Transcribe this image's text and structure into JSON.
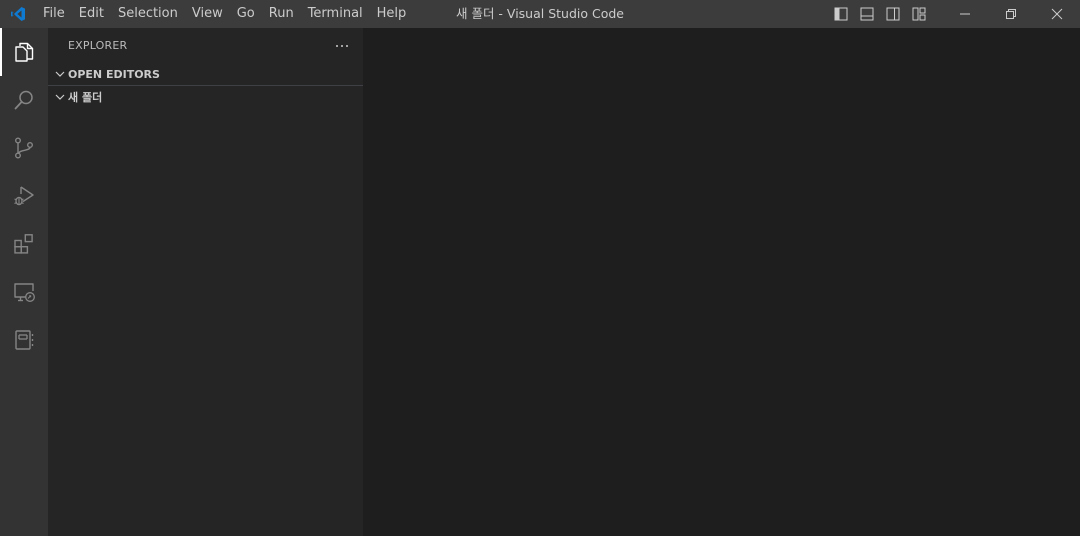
{
  "app": {
    "window_title": "새 폴더 - Visual Studio Code",
    "brand_color": "#0e7ad1"
  },
  "menu": {
    "items": [
      "File",
      "Edit",
      "Selection",
      "View",
      "Go",
      "Run",
      "Terminal",
      "Help"
    ]
  },
  "title_controls": {
    "layout_icons": [
      "toggle-primary-sidebar-icon",
      "toggle-panel-icon",
      "toggle-secondary-sidebar-icon",
      "customize-layout-icon"
    ],
    "window_icons": [
      "minimize-icon",
      "restore-icon",
      "close-icon"
    ]
  },
  "activity_bar": {
    "items": [
      {
        "icon": "explorer-icon",
        "active": true
      },
      {
        "icon": "search-icon",
        "active": false
      },
      {
        "icon": "source-control-icon",
        "active": false
      },
      {
        "icon": "run-debug-icon",
        "active": false
      },
      {
        "icon": "extensions-icon",
        "active": false
      },
      {
        "icon": "remote-explorer-icon",
        "active": false
      },
      {
        "icon": "notebook-icon",
        "active": false
      }
    ]
  },
  "sidebar": {
    "title": "EXPLORER",
    "more_actions": "···",
    "sections": [
      {
        "label": "OPEN EDITORS",
        "expanded": true
      },
      {
        "label": "새 폴더",
        "expanded": true
      }
    ]
  }
}
